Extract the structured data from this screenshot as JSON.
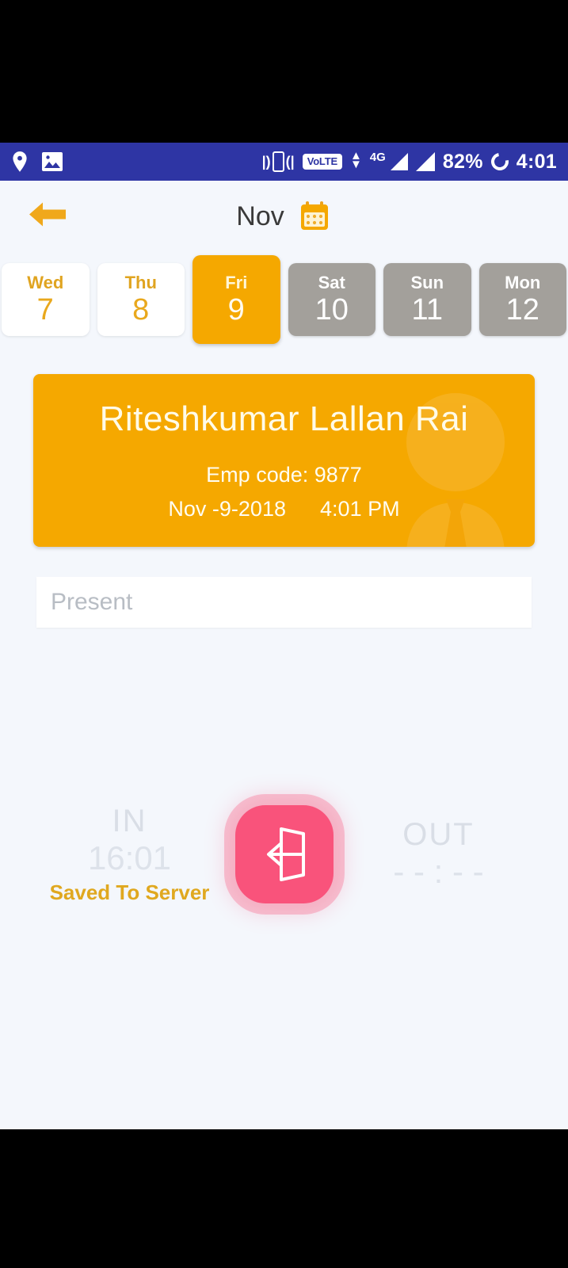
{
  "statusbar": {
    "icons_left": [
      "location-pin-icon",
      "image-icon"
    ],
    "vibrate_icon": "vibrate-icon",
    "volte_label": "VoLTE",
    "network_label": "4G",
    "battery_percent": "82%",
    "battery_icon": "battery-ring-icon",
    "clock": "4:01",
    "bg_color": "#2e35a4"
  },
  "appbar": {
    "back_icon": "back-arrow-icon",
    "title": "Nov",
    "calendar_icon": "calendar-icon",
    "accent_color": "#f5a800"
  },
  "datestrip": {
    "days": [
      {
        "dow": "Wed",
        "num": "7",
        "state": "white"
      },
      {
        "dow": "Thu",
        "num": "8",
        "state": "white"
      },
      {
        "dow": "Fri",
        "num": "9",
        "state": "selected"
      },
      {
        "dow": "Sat",
        "num": "10",
        "state": "gray"
      },
      {
        "dow": "Sun",
        "num": "11",
        "state": "gray"
      },
      {
        "dow": "Mon",
        "num": "12",
        "state": "gray"
      }
    ]
  },
  "employee_card": {
    "name": "Riteshkumar Lallan Rai",
    "emp_code_line": "Emp code: 9877",
    "date": "Nov -9-2018",
    "time": "4:01 PM",
    "avatar_watermark": "person-suit-icon",
    "bg_color": "#f5a800"
  },
  "status_field": {
    "value": "Present",
    "placeholder": "Present"
  },
  "punch": {
    "in_label": "IN",
    "in_time": "16:01",
    "in_status": "Saved To Server",
    "out_label": "OUT",
    "out_time": "- - : - -",
    "button_icon": "login-enter-icon",
    "button_color": "#f9537b",
    "saved_color": "#e0a81f"
  }
}
